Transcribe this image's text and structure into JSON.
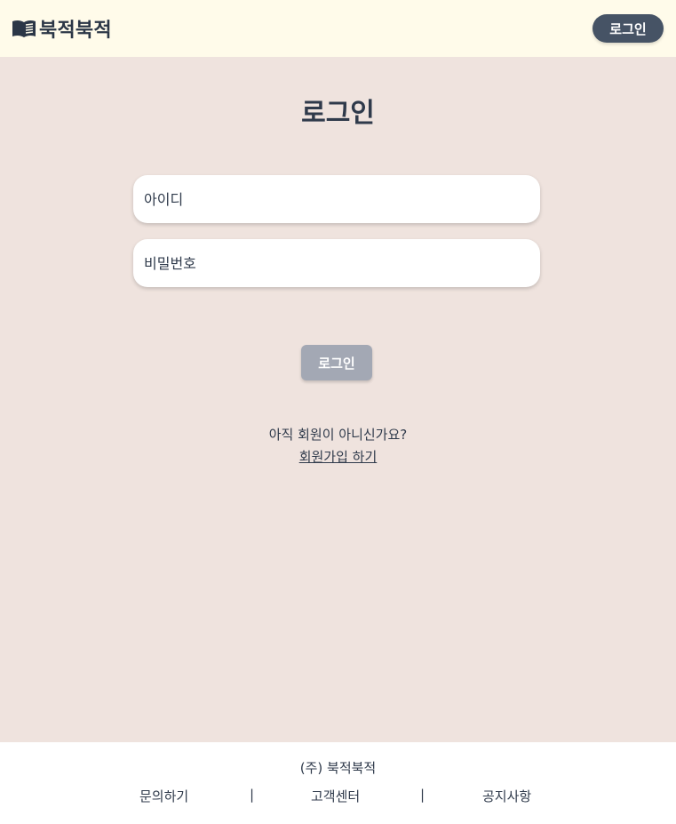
{
  "header": {
    "brand_icon": "open-book-icon",
    "brand_name": "북적북적",
    "login_label": "로그인"
  },
  "login_form": {
    "title": "로그인",
    "id_placeholder": "아이디",
    "password_placeholder": "비밀번호",
    "submit_label": "로그인",
    "signup_prompt": "아직 회원이 아니신가요?",
    "signup_link": "회원가입 하기"
  },
  "footer": {
    "company": "(주) 북적북적",
    "links": [
      "문의하기",
      "고객센터",
      "공지사항"
    ],
    "separator": "|"
  },
  "colors": {
    "header_bg": "#fffbea",
    "page_bg": "#efe3de",
    "header_button": "#465365",
    "submit_button": "#a3a8b4",
    "text": "#2f3a4b"
  }
}
